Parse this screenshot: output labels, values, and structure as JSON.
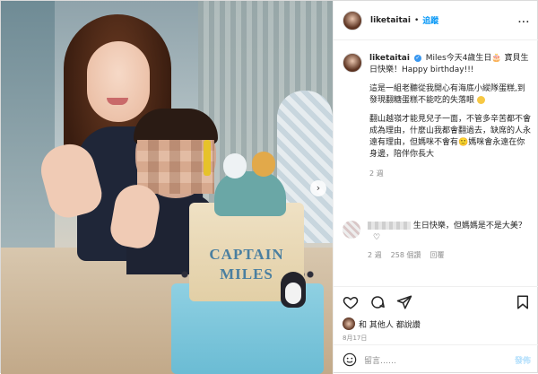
{
  "header": {
    "username": "liketaitai",
    "separator": "•",
    "follow_label": "追蹤",
    "more_label": "..."
  },
  "photo": {
    "cake_text_line1": "CAPTAIN",
    "cake_text_line2": "MILES",
    "next_glyph": "›"
  },
  "caption": {
    "username": "liketaitai",
    "verified_glyph": "✓",
    "line1": "Miles今天4歲生日🎂 寶貝生日快樂！Happy birthday!!!",
    "para2": "這是一組老聽從我開心有海底小縱隊蛋糕,到發現翻糖蛋糕不能吃的失落眼",
    "para3": "翻山越嶺才能見兒子一面，不管多辛苦都不會成為理由，什麼山我都會翻過去，缺席的人永遠有理由，但媽咪不會有🙂媽咪會永遠在你身邊，陪伴你長大",
    "time": "2 週"
  },
  "comment": {
    "text": "生日快樂，但媽媽是不是大美？",
    "time": "2 週",
    "likes": "258 個讚",
    "reply": "回覆"
  },
  "actions": {
    "liked_by": "和 其他人 都說讚",
    "date": "8月17日"
  },
  "composer": {
    "placeholder": "留言……",
    "post_label": "發佈"
  }
}
